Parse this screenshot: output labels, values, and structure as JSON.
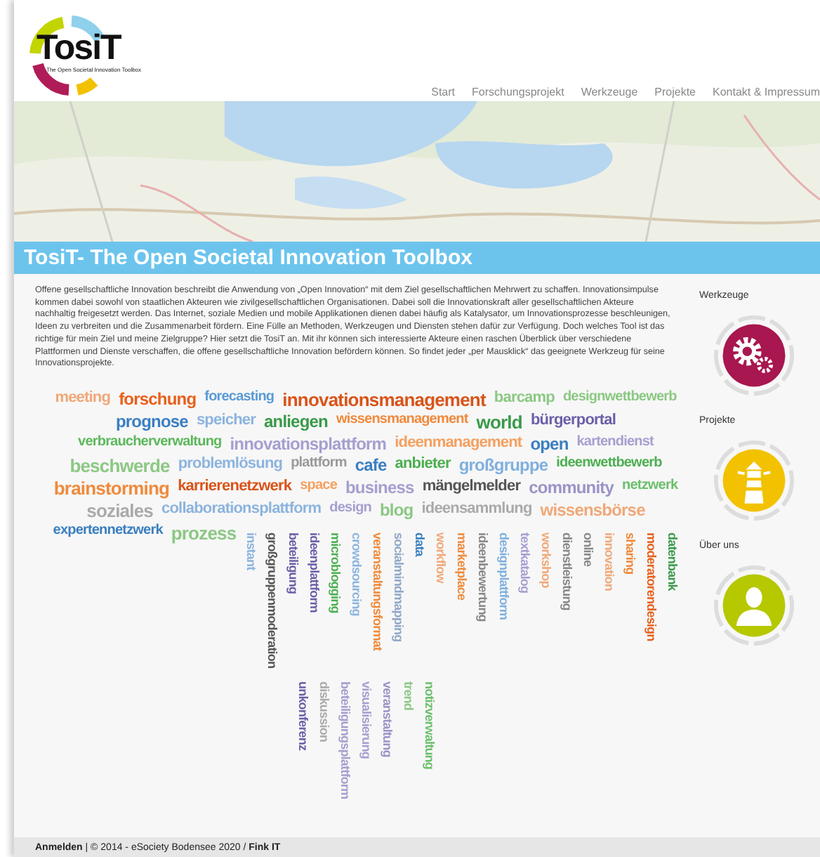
{
  "logo": {
    "name": "TosiT",
    "tagline": "The Open Societal Innovation Toolbox"
  },
  "nav": [
    "Start",
    "Forschungsprojekt",
    "Werkzeuge",
    "Projekte",
    "Kontakt & Impressum"
  ],
  "title": "TosiT- The Open Societal Innovation Toolbox",
  "intro": "Offene gesellschaftliche Innovation beschreibt die Anwendung von „Open Innovation“ mit dem Ziel gesellschaftlichen Mehrwert zu schaffen. Innovationsimpulse kommen dabei sowohl von staatlichen Akteuren wie zivilgesellschaftlichen Organisationen. Dabei soll die Innovationskraft aller gesellschaftlichen Akteure nachhaltig freigesetzt werden. Das Internet, soziale Medien und mobile Applikationen dienen dabei häufig als Katalysator, um Innovationsprozesse beschleunigen, Ideen zu verbreiten und die Zusammenarbeit fördern. Eine Fülle an Methoden, Werkzeugen und Diensten stehen dafür zur Verfügung. Doch welches Tool ist das richtige für mein Ziel und meine Zielgruppe? Hier setzt die TosiT an. Mit ihr können sich interessierte Akteure einen raschen Überblick über verschiedene Plattformen und Dienste verschaffen, die offene gesellschaftliche Innovation befördern können. So findet jeder „per Mausklick“ das geeignete Werkzeug für seine Innovationsprojekte.",
  "sidebar": [
    {
      "label": "Werkzeuge",
      "color": "#a8174f"
    },
    {
      "label": "Projekte",
      "color": "#f2c200"
    },
    {
      "label": "Über uns",
      "color": "#b5c800"
    }
  ],
  "tag_cloud": [
    {
      "text": "meeting",
      "kind": "horizontal",
      "color": "#f0a878"
    },
    {
      "text": "forschung",
      "kind": "horizontal",
      "color": "#e8601c"
    },
    {
      "text": "forecasting",
      "kind": "horizontal",
      "color": "#5a9bd5"
    },
    {
      "text": "innovationsmanagement",
      "kind": "horizontal",
      "color": "#d9541a"
    },
    {
      "text": "barcamp",
      "kind": "horizontal",
      "color": "#8cc884"
    },
    {
      "text": "designwettbewerb",
      "kind": "horizontal",
      "color": "#8cc884"
    },
    {
      "text": "prognose",
      "kind": "horizontal",
      "color": "#3a7fc1"
    },
    {
      "text": "speicher",
      "kind": "horizontal",
      "color": "#8cb4de"
    },
    {
      "text": "anliegen",
      "kind": "horizontal",
      "color": "#3a9a4a"
    },
    {
      "text": "wissensmanagement",
      "kind": "horizontal",
      "color": "#f08a3c"
    },
    {
      "text": "world",
      "kind": "horizontal",
      "color": "#3a9a4a"
    },
    {
      "text": "bürgerportal",
      "kind": "horizontal",
      "color": "#6a5fa8"
    },
    {
      "text": "verbraucherverwaltung",
      "kind": "horizontal",
      "color": "#5cb85c"
    },
    {
      "text": "innovationsplattform",
      "kind": "horizontal",
      "color": "#a59fd0"
    },
    {
      "text": "ideenmanagement",
      "kind": "horizontal",
      "color": "#f5a060"
    },
    {
      "text": "open",
      "kind": "horizontal",
      "color": "#3a7fc1"
    },
    {
      "text": "kartendienst",
      "kind": "horizontal",
      "color": "#a59fd0"
    },
    {
      "text": "beschwerde",
      "kind": "horizontal",
      "color": "#8cc884"
    },
    {
      "text": "problemlösung",
      "kind": "horizontal",
      "color": "#8cb4de"
    },
    {
      "text": "plattform",
      "kind": "horizontal",
      "color": "#999999"
    },
    {
      "text": "cafe",
      "kind": "horizontal",
      "color": "#3a7fc1"
    },
    {
      "text": "anbieter",
      "kind": "horizontal",
      "color": "#4caf50"
    },
    {
      "text": "großgruppe",
      "kind": "horizontal",
      "color": "#7fb0de"
    },
    {
      "text": "ideenwettbewerb",
      "kind": "horizontal",
      "color": "#4caf50"
    },
    {
      "text": "brainstorming",
      "kind": "horizontal",
      "color": "#f08a3c"
    },
    {
      "text": "karrierenetzwerk",
      "kind": "horizontal",
      "color": "#d9541a"
    },
    {
      "text": "space",
      "kind": "horizontal",
      "color": "#f5a060"
    },
    {
      "text": "business",
      "kind": "horizontal",
      "color": "#a59fd0"
    },
    {
      "text": "mängelmelder",
      "kind": "horizontal",
      "color": "#555555"
    },
    {
      "text": "community",
      "kind": "horizontal",
      "color": "#9a94c8"
    },
    {
      "text": "netzwerk",
      "kind": "horizontal",
      "color": "#6cbf6c"
    },
    {
      "text": "soziales",
      "kind": "horizontal",
      "color": "#aaaaaa"
    },
    {
      "text": "collaborationsplattform",
      "kind": "horizontal",
      "color": "#8cb4de"
    },
    {
      "text": "design",
      "kind": "horizontal",
      "color": "#a59fd0"
    },
    {
      "text": "blog",
      "kind": "horizontal",
      "color": "#8cc884"
    },
    {
      "text": "ideensammlung",
      "kind": "horizontal",
      "color": "#aaaaaa"
    },
    {
      "text": "wissensbörse",
      "kind": "horizontal",
      "color": "#f0a878"
    },
    {
      "text": "expertennetzwerk",
      "kind": "horizontal",
      "color": "#3a7fc1"
    },
    {
      "text": "prozess",
      "kind": "horizontal",
      "color": "#8cc884"
    },
    {
      "text": "instant",
      "kind": "vertical",
      "color": "#8cb4de"
    },
    {
      "text": "großgruppenmoderation",
      "kind": "vertical",
      "color": "#555555"
    },
    {
      "text": "beteiligung",
      "kind": "vertical",
      "color": "#6a5fa8"
    },
    {
      "text": "ideenplattform",
      "kind": "vertical",
      "color": "#6a5fa8"
    },
    {
      "text": "microblogging",
      "kind": "vertical",
      "color": "#4caf50"
    },
    {
      "text": "crowdsourcing",
      "kind": "vertical",
      "color": "#8cb4de"
    },
    {
      "text": "veranstaltungsformat",
      "kind": "vertical",
      "color": "#f08a3c"
    },
    {
      "text": "socialmindmapping",
      "kind": "vertical",
      "color": "#8fa8c8"
    },
    {
      "text": "data",
      "kind": "vertical",
      "color": "#3a7fc1"
    },
    {
      "text": "workflow",
      "kind": "vertical",
      "color": "#f0a878"
    },
    {
      "text": "marketplace",
      "kind": "vertical",
      "color": "#f08a3c"
    },
    {
      "text": "ideenbewertung",
      "kind": "vertical",
      "color": "#888888"
    },
    {
      "text": "designplattform",
      "kind": "vertical",
      "color": "#7fb0de"
    },
    {
      "text": "textkatalog",
      "kind": "vertical",
      "color": "#a59fd0"
    },
    {
      "text": "workshop",
      "kind": "vertical",
      "color": "#f0a878"
    },
    {
      "text": "dienstleistung",
      "kind": "vertical",
      "color": "#888888"
    },
    {
      "text": "online",
      "kind": "vertical",
      "color": "#888888"
    },
    {
      "text": "innovation",
      "kind": "vertical",
      "color": "#f0a878"
    },
    {
      "text": "sharing",
      "kind": "vertical",
      "color": "#f08a3c"
    },
    {
      "text": "moderatorendesign",
      "kind": "vertical",
      "color": "#e8601c"
    },
    {
      "text": "datenbank",
      "kind": "vertical",
      "color": "#3a9a4a"
    },
    {
      "text": "unkonferenz",
      "kind": "vertical",
      "color": "#6a5fa8"
    },
    {
      "text": "diskussion",
      "kind": "vertical",
      "color": "#aaaaaa"
    },
    {
      "text": "beteiligungsplattform",
      "kind": "vertical",
      "color": "#a59fd0"
    },
    {
      "text": "visualisierung",
      "kind": "vertical",
      "color": "#a59fd0"
    },
    {
      "text": "veranstaltung",
      "kind": "vertical",
      "color": "#9a94c8"
    },
    {
      "text": "trend",
      "kind": "vertical",
      "color": "#8cc884"
    },
    {
      "text": "notizverwaltung",
      "kind": "vertical",
      "color": "#6cbf6c"
    }
  ],
  "footer": "**Anmelden** | © 2014 - eSociety Bodensee 2020 / **Fink IT**"
}
